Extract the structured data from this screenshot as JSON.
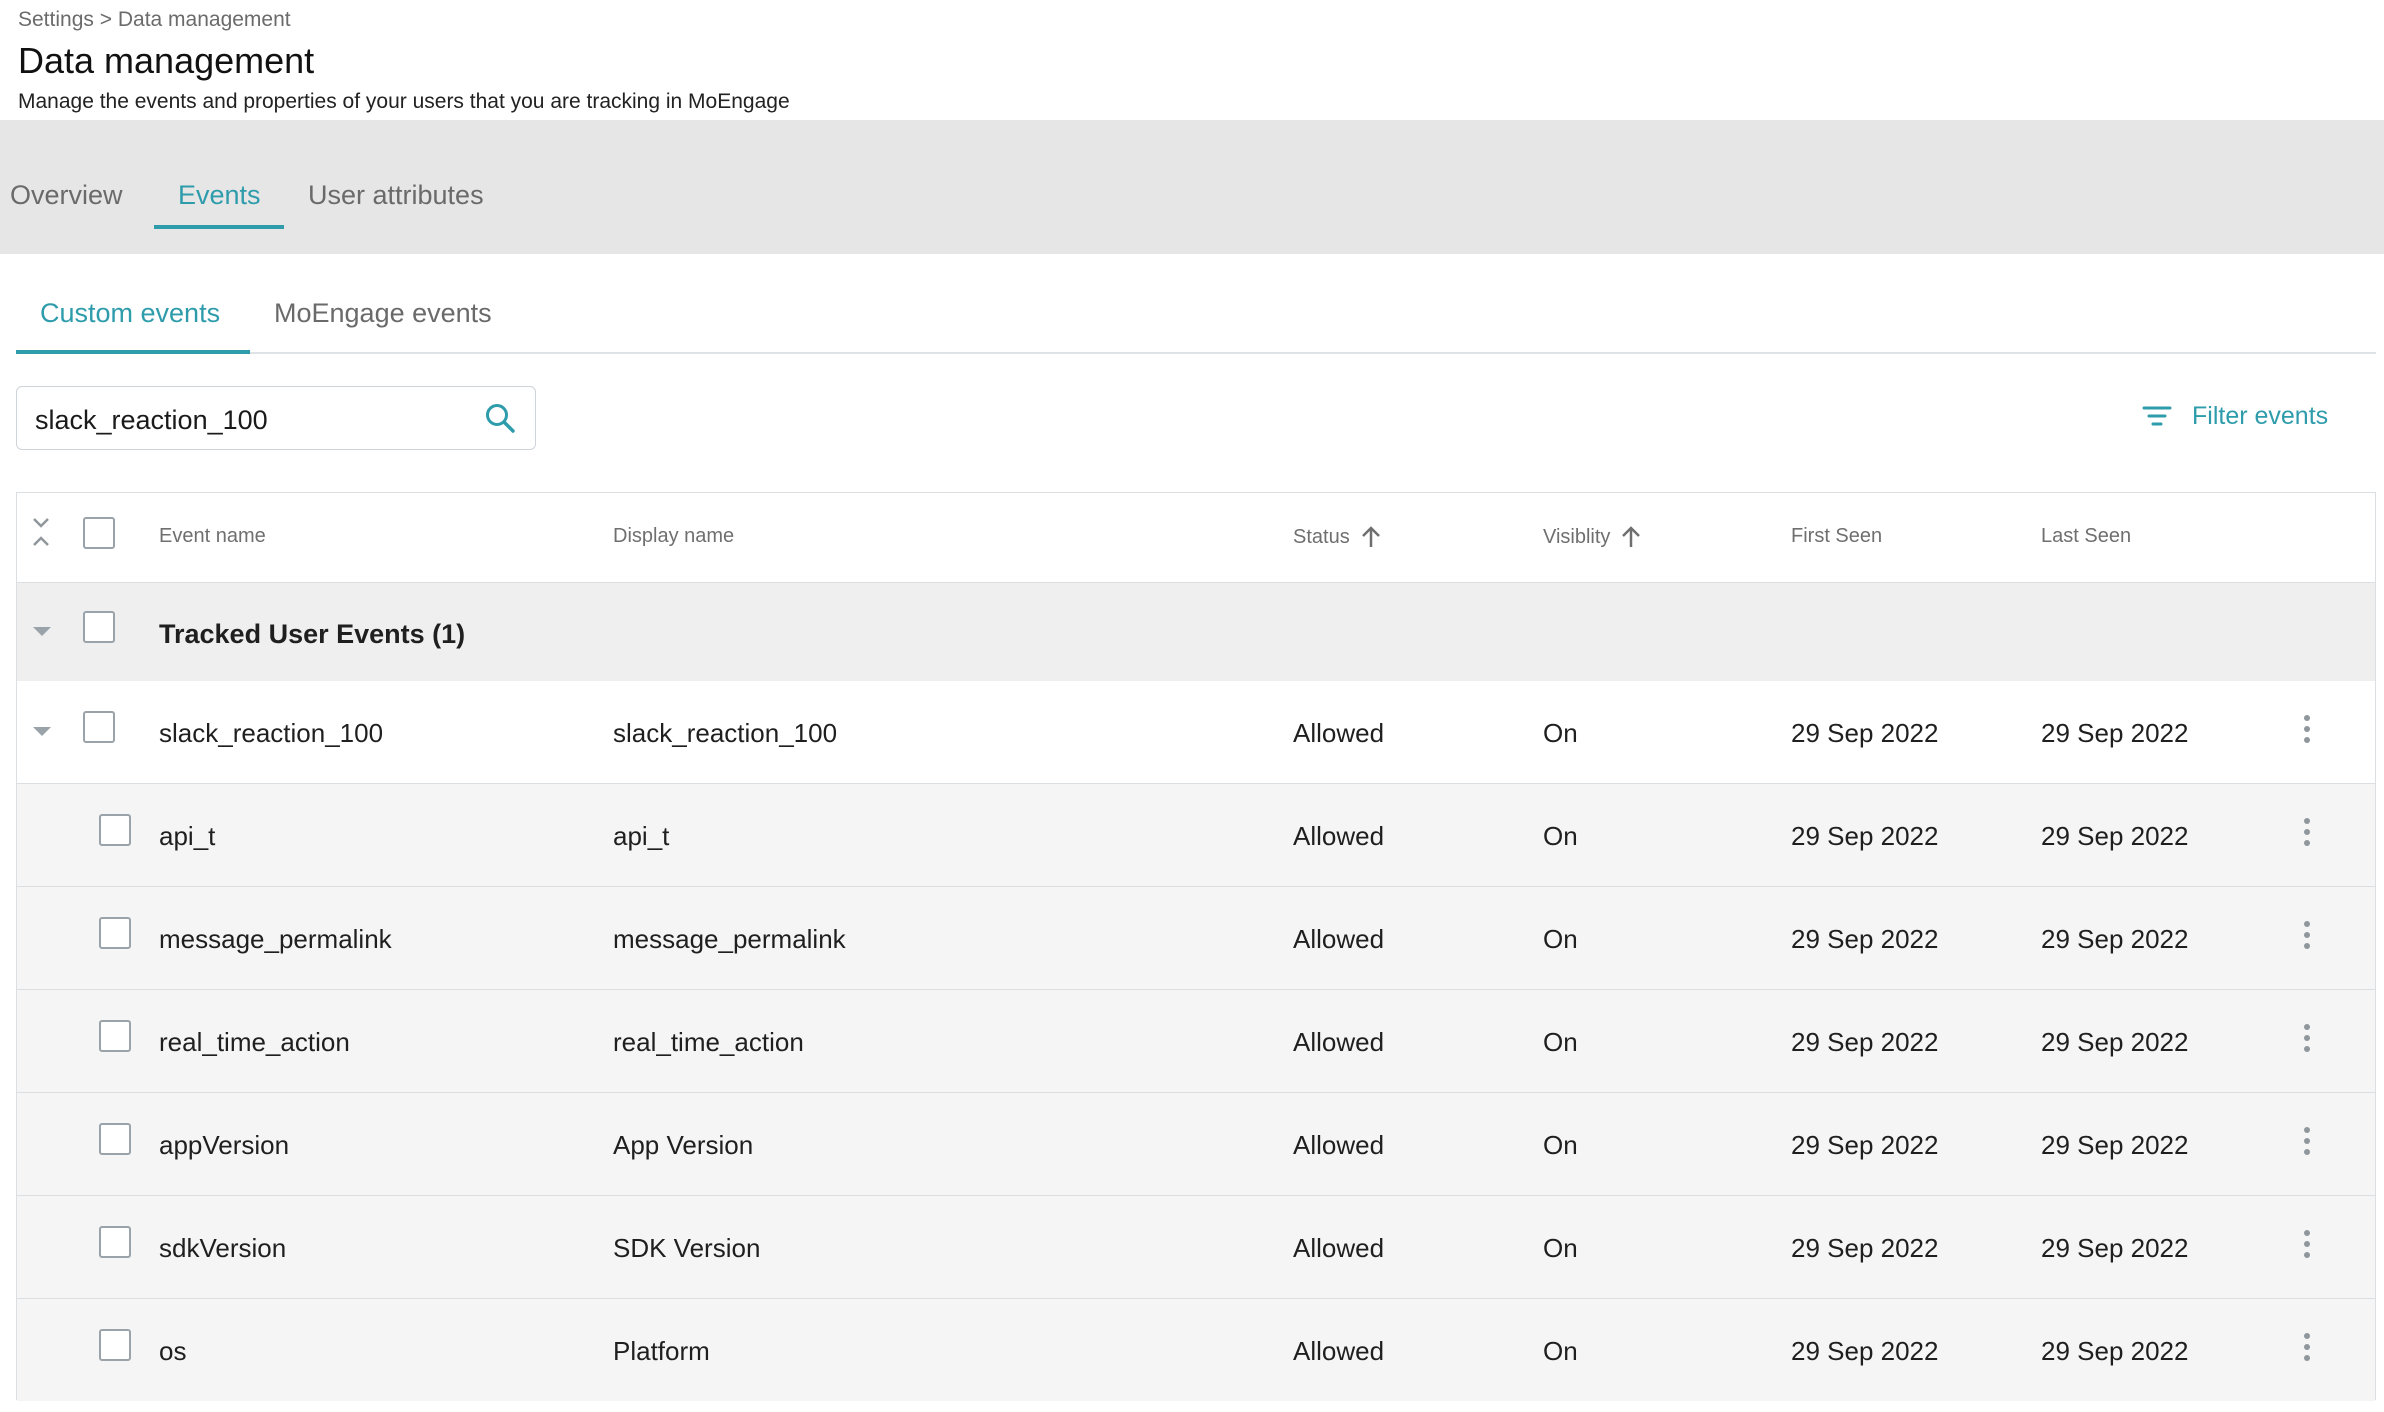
{
  "breadcrumb": {
    "root": "Settings",
    "separator": ">",
    "current": "Data management"
  },
  "header": {
    "title": "Data management",
    "subtitle": "Manage the events and properties of your users that you are tracking in MoEngage"
  },
  "tabs": [
    {
      "label": "Overview",
      "active": false
    },
    {
      "label": "Events",
      "active": true
    },
    {
      "label": "User attributes",
      "active": false
    }
  ],
  "subtabs": [
    {
      "label": "Custom events",
      "active": true
    },
    {
      "label": "MoEngage events",
      "active": false
    }
  ],
  "search": {
    "value": "slack_reaction_100",
    "icon": "search-icon"
  },
  "filter": {
    "label": "Filter events",
    "icon": "filter-icon"
  },
  "table": {
    "columns": {
      "event_name": "Event name",
      "display_name": "Display name",
      "status": "Status",
      "visibility": "Visiblity",
      "first_seen": "First Seen",
      "last_seen": "Last Seen"
    },
    "group": {
      "title": "Tracked User Events (1)"
    },
    "parent": {
      "event_name": "slack_reaction_100",
      "display_name": "slack_reaction_100",
      "status": "Allowed",
      "visibility": "On",
      "first_seen": "29 Sep 2022",
      "last_seen": "29 Sep 2022"
    },
    "rows": [
      {
        "event_name": "api_t",
        "display_name": "api_t",
        "status": "Allowed",
        "visibility": "On",
        "first_seen": "29 Sep 2022",
        "last_seen": "29 Sep 2022"
      },
      {
        "event_name": "message_permalink",
        "display_name": "message_permalink",
        "status": "Allowed",
        "visibility": "On",
        "first_seen": "29 Sep 2022",
        "last_seen": "29 Sep 2022"
      },
      {
        "event_name": "real_time_action",
        "display_name": "real_time_action",
        "status": "Allowed",
        "visibility": "On",
        "first_seen": "29 Sep 2022",
        "last_seen": "29 Sep 2022"
      },
      {
        "event_name": "appVersion",
        "display_name": "App Version",
        "status": "Allowed",
        "visibility": "On",
        "first_seen": "29 Sep 2022",
        "last_seen": "29 Sep 2022"
      },
      {
        "event_name": "sdkVersion",
        "display_name": "SDK Version",
        "status": "Allowed",
        "visibility": "On",
        "first_seen": "29 Sep 2022",
        "last_seen": "29 Sep 2022"
      },
      {
        "event_name": "os",
        "display_name": "Platform",
        "status": "Allowed",
        "visibility": "On",
        "first_seen": "29 Sep 2022",
        "last_seen": "29 Sep 2022"
      }
    ]
  },
  "colors": {
    "accent": "#2e9cab",
    "tabbar_bg": "#e6e6e6",
    "group_bg": "#efefef",
    "row_bg": "#f5f5f5"
  }
}
